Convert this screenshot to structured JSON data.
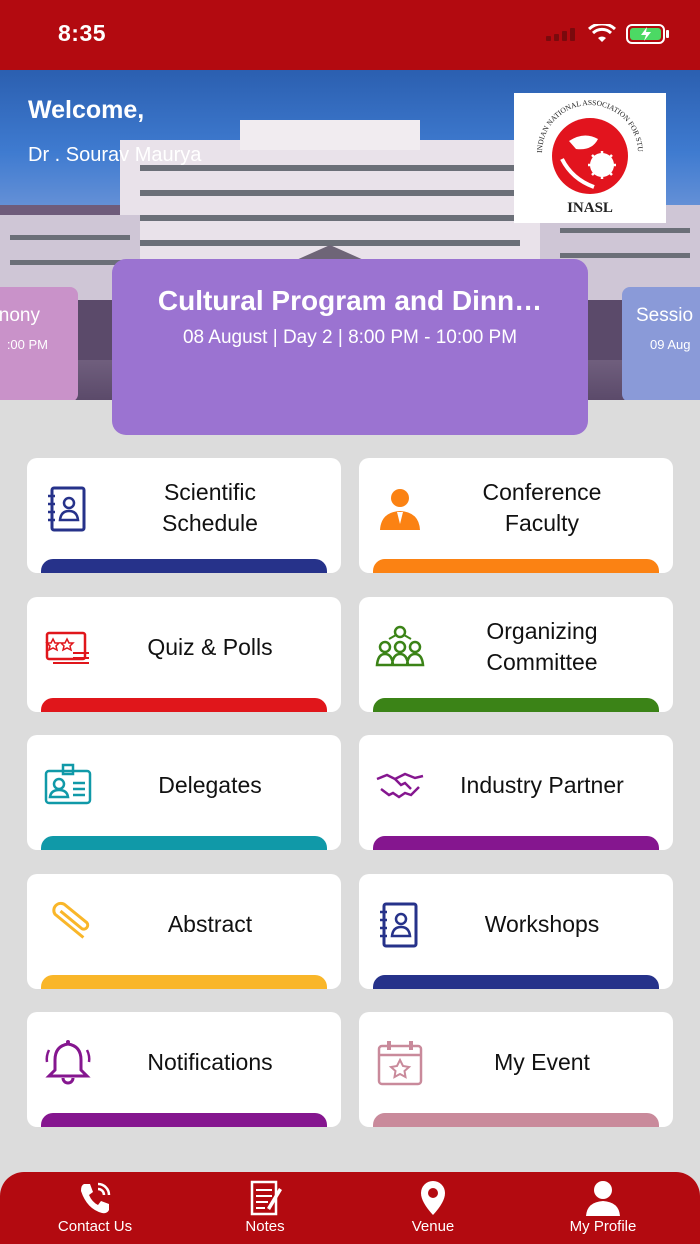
{
  "status_bar": {
    "time": "8:35"
  },
  "header": {
    "welcome": "Welcome,",
    "user_name": "Dr . Sourav Maurya",
    "logo_text": "INASL",
    "logo_ring_text": "INDIAN NATIONAL ASSOCIATION FOR STUDY OF THE LIVER"
  },
  "carousel": {
    "prev": {
      "title": "nony",
      "time": ":00 PM"
    },
    "current": {
      "title": "Cultural Program and Dinn…",
      "subtitle": "08 August | Day 2 | 8:00 PM - 10:00 PM"
    },
    "next": {
      "title": "Sessio",
      "time": "09 Aug"
    }
  },
  "menu": [
    {
      "label": "Scientific\nSchedule",
      "icon": "contact-book-icon",
      "color": "#26328a"
    },
    {
      "label": "Conference\nFaculty",
      "icon": "person-icon",
      "color": "#fb8213"
    },
    {
      "label": "Quiz & Polls",
      "icon": "star-chart-icon",
      "color": "#e0161b"
    },
    {
      "label": "Organizing\nCommittee",
      "icon": "team-icon",
      "color": "#3b8317"
    },
    {
      "label": "Delegates",
      "icon": "id-badge-icon",
      "color": "#1099a8"
    },
    {
      "label": "Industry Partner",
      "icon": "handshake-icon",
      "color": "#85168f"
    },
    {
      "label": "Abstract",
      "icon": "paperclip-icon",
      "color": "#f9b629"
    },
    {
      "label": "Workshops",
      "icon": "contact-book-icon",
      "color": "#26328a"
    },
    {
      "label": "Notifications",
      "icon": "bell-icon",
      "color": "#85168f"
    },
    {
      "label": "My Event",
      "icon": "calendar-star-icon",
      "color": "#c98a9b"
    }
  ],
  "bottom_nav": [
    {
      "label": "Contact Us",
      "icon": "phone-icon"
    },
    {
      "label": "Notes",
      "icon": "notes-icon"
    },
    {
      "label": "Venue",
      "icon": "location-pin-icon"
    },
    {
      "label": "My Profile",
      "icon": "user-icon"
    }
  ]
}
